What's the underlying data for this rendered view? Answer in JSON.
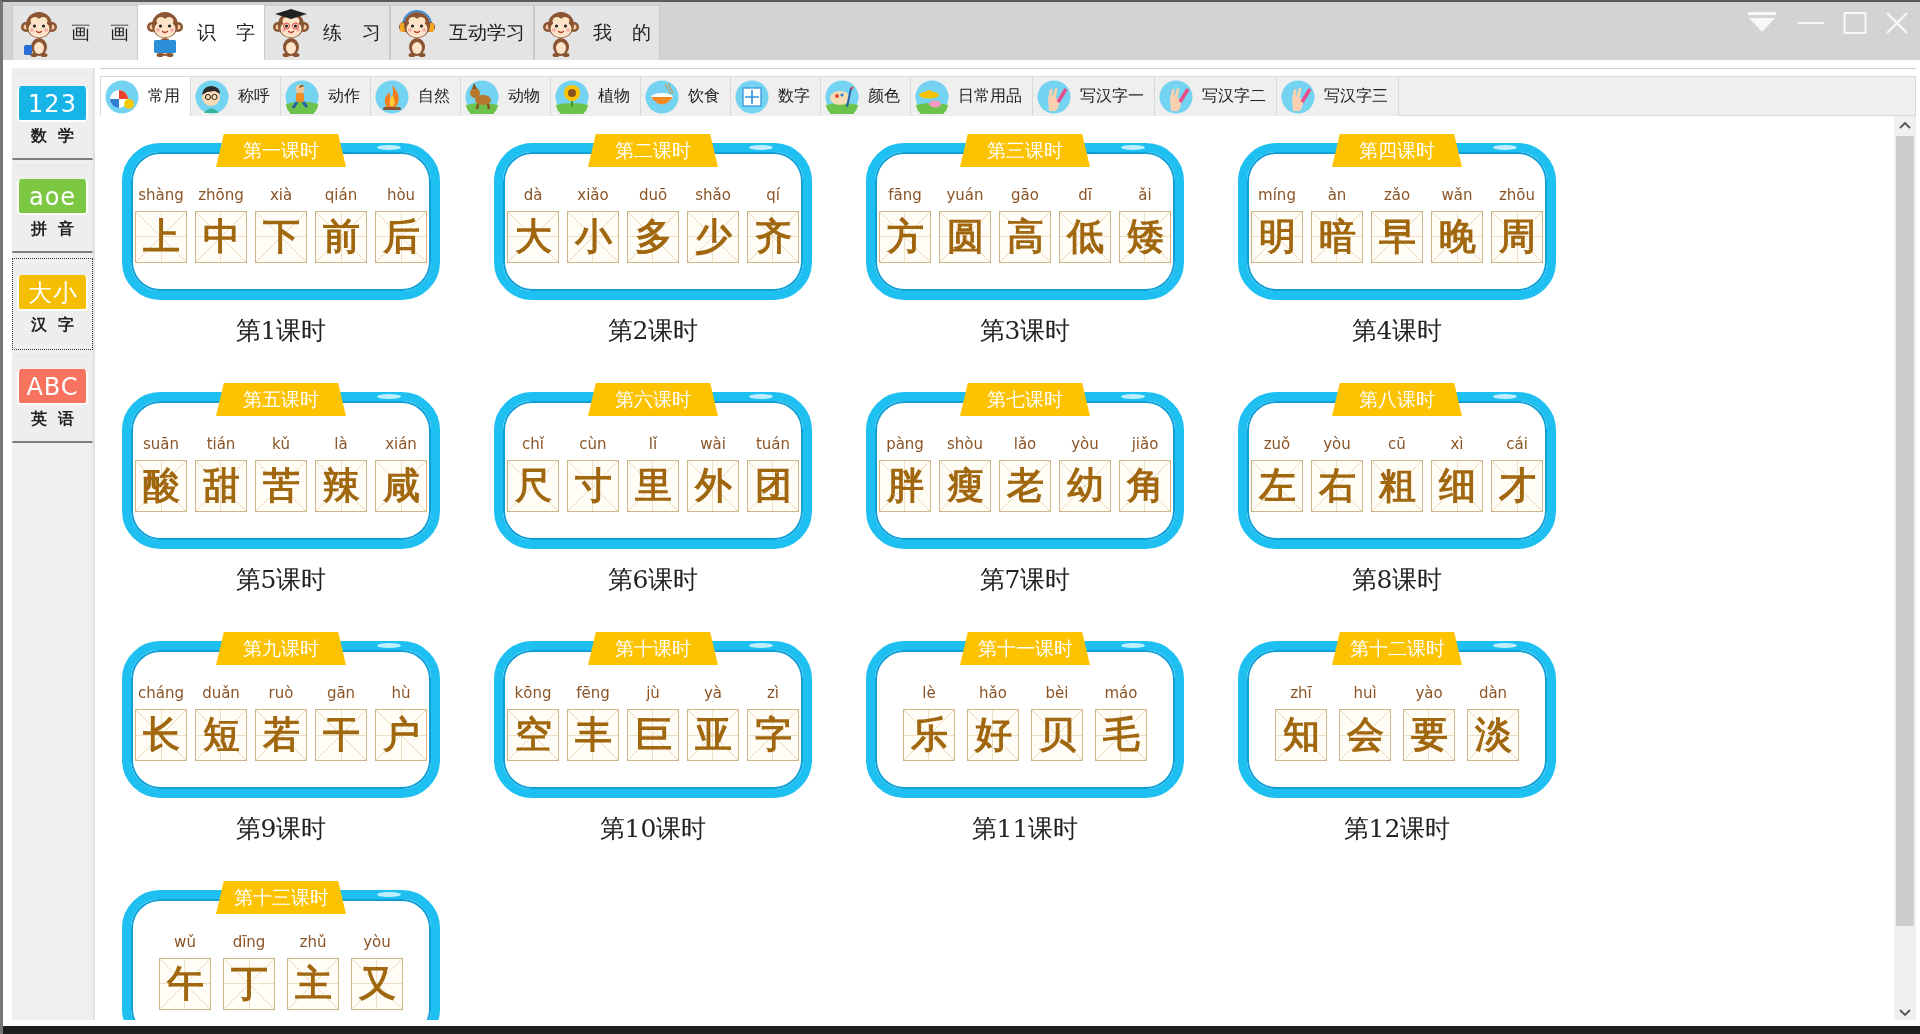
{
  "nav_tabs": [
    {
      "label": "画 画",
      "selected": false
    },
    {
      "label": "识 字",
      "selected": true
    },
    {
      "label": "练 习",
      "selected": false
    },
    {
      "label": "互动学习",
      "selected": false
    },
    {
      "label": "我 的",
      "selected": false
    }
  ],
  "sidebar": {
    "items": [
      {
        "logo": "123",
        "label": "数 学",
        "color": "#17b4e8",
        "selected": false
      },
      {
        "logo": "aoe",
        "label": "拼 音",
        "color": "#7cc843",
        "selected": false
      },
      {
        "logo": "大小",
        "label": "汉 字",
        "color": "#f6be00",
        "selected": true
      },
      {
        "logo": "ABC",
        "label": "英 语",
        "color": "#f7735f",
        "selected": false
      }
    ]
  },
  "category_tabs": [
    {
      "label": "常用",
      "selected": true
    },
    {
      "label": "称呼",
      "selected": false
    },
    {
      "label": "动作",
      "selected": false
    },
    {
      "label": "自然",
      "selected": false
    },
    {
      "label": "动物",
      "selected": false
    },
    {
      "label": "植物",
      "selected": false
    },
    {
      "label": "饮食",
      "selected": false
    },
    {
      "label": "数字",
      "selected": false
    },
    {
      "label": "颜色",
      "selected": false
    },
    {
      "label": "日常用品",
      "selected": false
    },
    {
      "label": "写汉字一",
      "selected": false
    },
    {
      "label": "写汉字二",
      "selected": false
    },
    {
      "label": "写汉字三",
      "selected": false
    }
  ],
  "lessons": [
    {
      "ribbon": "第一课时",
      "caption": "第1课时",
      "characters": [
        {
          "pinyin": "shàng",
          "hanzi": "上"
        },
        {
          "pinyin": "zhōng",
          "hanzi": "中"
        },
        {
          "pinyin": "xià",
          "hanzi": "下"
        },
        {
          "pinyin": "qián",
          "hanzi": "前"
        },
        {
          "pinyin": "hòu",
          "hanzi": "后"
        }
      ]
    },
    {
      "ribbon": "第二课时",
      "caption": "第2课时",
      "characters": [
        {
          "pinyin": "dà",
          "hanzi": "大"
        },
        {
          "pinyin": "xiǎo",
          "hanzi": "小"
        },
        {
          "pinyin": "duō",
          "hanzi": "多"
        },
        {
          "pinyin": "shǎo",
          "hanzi": "少"
        },
        {
          "pinyin": "qí",
          "hanzi": "齐"
        }
      ]
    },
    {
      "ribbon": "第三课时",
      "caption": "第3课时",
      "characters": [
        {
          "pinyin": "fāng",
          "hanzi": "方"
        },
        {
          "pinyin": "yuán",
          "hanzi": "圆"
        },
        {
          "pinyin": "gāo",
          "hanzi": "高"
        },
        {
          "pinyin": "dī",
          "hanzi": "低"
        },
        {
          "pinyin": "ǎi",
          "hanzi": "矮"
        }
      ]
    },
    {
      "ribbon": "第四课时",
      "caption": "第4课时",
      "characters": [
        {
          "pinyin": "míng",
          "hanzi": "明"
        },
        {
          "pinyin": "àn",
          "hanzi": "暗"
        },
        {
          "pinyin": "zǎo",
          "hanzi": "早"
        },
        {
          "pinyin": "wǎn",
          "hanzi": "晚"
        },
        {
          "pinyin": "zhōu",
          "hanzi": "周"
        }
      ]
    },
    {
      "ribbon": "第五课时",
      "caption": "第5课时",
      "characters": [
        {
          "pinyin": "suān",
          "hanzi": "酸"
        },
        {
          "pinyin": "tián",
          "hanzi": "甜"
        },
        {
          "pinyin": "kǔ",
          "hanzi": "苦"
        },
        {
          "pinyin": "là",
          "hanzi": "辣"
        },
        {
          "pinyin": "xián",
          "hanzi": "咸"
        }
      ]
    },
    {
      "ribbon": "第六课时",
      "caption": "第6课时",
      "characters": [
        {
          "pinyin": "chǐ",
          "hanzi": "尺"
        },
        {
          "pinyin": "cùn",
          "hanzi": "寸"
        },
        {
          "pinyin": "lǐ",
          "hanzi": "里"
        },
        {
          "pinyin": "wài",
          "hanzi": "外"
        },
        {
          "pinyin": "tuán",
          "hanzi": "团"
        }
      ]
    },
    {
      "ribbon": "第七课时",
      "caption": "第7课时",
      "characters": [
        {
          "pinyin": "pàng",
          "hanzi": "胖"
        },
        {
          "pinyin": "shòu",
          "hanzi": "瘦"
        },
        {
          "pinyin": "lǎo",
          "hanzi": "老"
        },
        {
          "pinyin": "yòu",
          "hanzi": "幼"
        },
        {
          "pinyin": "jiǎo",
          "hanzi": "角"
        }
      ]
    },
    {
      "ribbon": "第八课时",
      "caption": "第8课时",
      "characters": [
        {
          "pinyin": "zuǒ",
          "hanzi": "左"
        },
        {
          "pinyin": "yòu",
          "hanzi": "右"
        },
        {
          "pinyin": "cū",
          "hanzi": "粗"
        },
        {
          "pinyin": "xì",
          "hanzi": "细"
        },
        {
          "pinyin": "cái",
          "hanzi": "才"
        }
      ]
    },
    {
      "ribbon": "第九课时",
      "caption": "第9课时",
      "characters": [
        {
          "pinyin": "cháng",
          "hanzi": "长"
        },
        {
          "pinyin": "duǎn",
          "hanzi": "短"
        },
        {
          "pinyin": "ruò",
          "hanzi": "若"
        },
        {
          "pinyin": "gān",
          "hanzi": "干"
        },
        {
          "pinyin": "hù",
          "hanzi": "户"
        }
      ]
    },
    {
      "ribbon": "第十课时",
      "caption": "第10课时",
      "characters": [
        {
          "pinyin": "kōng",
          "hanzi": "空"
        },
        {
          "pinyin": "fēng",
          "hanzi": "丰"
        },
        {
          "pinyin": "jù",
          "hanzi": "巨"
        },
        {
          "pinyin": "yà",
          "hanzi": "亚"
        },
        {
          "pinyin": "zì",
          "hanzi": "字"
        }
      ]
    },
    {
      "ribbon": "第十一课时",
      "caption": "第11课时",
      "characters": [
        {
          "pinyin": "lè",
          "hanzi": "乐"
        },
        {
          "pinyin": "hǎo",
          "hanzi": "好"
        },
        {
          "pinyin": "bèi",
          "hanzi": "贝"
        },
        {
          "pinyin": "máo",
          "hanzi": "毛"
        }
      ]
    },
    {
      "ribbon": "第十二课时",
      "caption": "第12课时",
      "characters": [
        {
          "pinyin": "zhī",
          "hanzi": "知"
        },
        {
          "pinyin": "huì",
          "hanzi": "会"
        },
        {
          "pinyin": "yào",
          "hanzi": "要"
        },
        {
          "pinyin": "dàn",
          "hanzi": "淡"
        }
      ]
    },
    {
      "ribbon": "第十三课时",
      "characters": [
        {
          "pinyin": "wǔ",
          "hanzi": "午"
        },
        {
          "pinyin": "dīng",
          "hanzi": "丁"
        },
        {
          "pinyin": "zhǔ",
          "hanzi": "主"
        },
        {
          "pinyin": "yòu",
          "hanzi": "又"
        }
      ]
    }
  ]
}
